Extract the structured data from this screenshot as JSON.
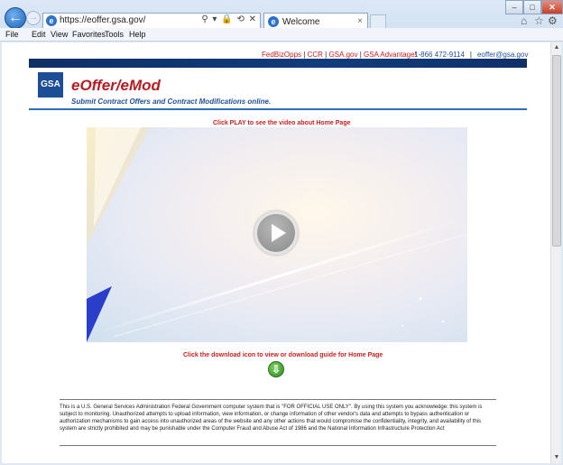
{
  "browser": {
    "address_url": "https://eoffer.gsa.gov/",
    "address_favicon": "e",
    "address_icons": "⚲ ▾ 🔒 ⟲ ✕",
    "tab_title": "Welcome",
    "tab_favicon": "e",
    "tab_close": "×",
    "back_glyph": "←",
    "forward_glyph": "→",
    "window_buttons": {
      "minimize": "–",
      "maximize": "□",
      "close": "✕"
    },
    "toolbar_icons": {
      "home": "⌂",
      "favorites": "☆",
      "tools": "⚙"
    },
    "menu": [
      "File",
      "Edit",
      "View",
      "Favorites",
      "Tools",
      "Help"
    ]
  },
  "header": {
    "links": [
      "FedBizOpps",
      "CCR",
      "GSA.gov",
      "GSA Advantage!"
    ],
    "link_separator": "|",
    "phone": "1-866 472-9114",
    "contact_separator": "|",
    "email": "eoffer@gsa.gov",
    "logo_text": "GSA",
    "title": "eOffer/eMod",
    "tagline": "Submit Contract Offers and Contract  Modifications online."
  },
  "main": {
    "play_instruction": "Click PLAY to see the video about Home Page",
    "download_instruction": "Click the download icon to view or download guide for Home Page",
    "download_glyph": "⇩"
  },
  "disclaimer": "This is a U.S. General Services Administration Federal Government computer system that is \"FOR OFFICIAL USE ONLY\". By using this system you acknowledge: this system is subject to monitoring. Unauthorized attempts to upload information, view information, or change information of other vendor's data and attempts to bypass authentication or authorization mechanisms to gain access into unauthorized areas of the website and any other actions that would compromise the confidentiality, integrity, and availability of this system are strictly prohibited and may be punishable under the Computer Fraud and Abuse Act of 1986 and the National Information Infrastructure Protection Act",
  "colors": {
    "accent_red": "#c8201f",
    "brand_blue": "#1f4f9a",
    "navy_band": "#123c7d",
    "download_green": "#2a8a22"
  },
  "icons": {
    "back": "back-arrow-icon",
    "forward": "forward-arrow-icon",
    "home": "home-icon",
    "favorites": "star-icon",
    "tools": "gear-icon",
    "play": "play-icon",
    "download": "download-arrow-icon"
  }
}
